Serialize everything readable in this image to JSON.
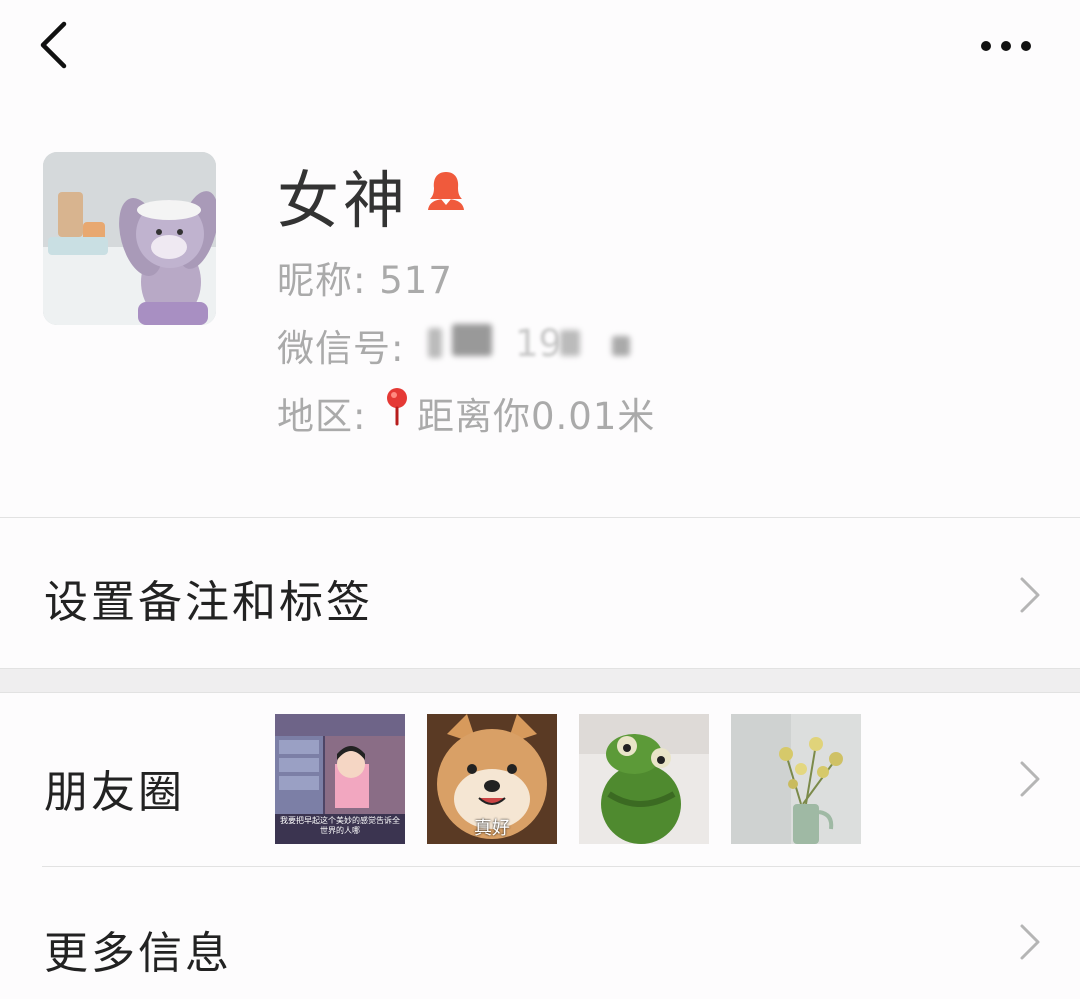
{
  "nav": {
    "back_icon": "chevron-left-icon",
    "more_icon": "more-dots-icon"
  },
  "profile": {
    "name": "女神",
    "gender_icon": "female-person-icon",
    "gender_color": "#f05a3c",
    "nickname_label": "昵称:",
    "nickname": "517",
    "wechat_id_label": "微信号:",
    "wechat_id_visible": "19",
    "region_label": "地区:",
    "region_icon": "location-pin-icon",
    "region_value": "距离你0.01米"
  },
  "menu": {
    "remark_label": "设置备注和标签",
    "moments_label": "朋友圈",
    "more_info_label": "更多信息"
  },
  "moments": {
    "thumb1_caption": "我要把早起这个美妙的感觉告诉全世界的人哪",
    "thumb2_caption": "真好"
  }
}
